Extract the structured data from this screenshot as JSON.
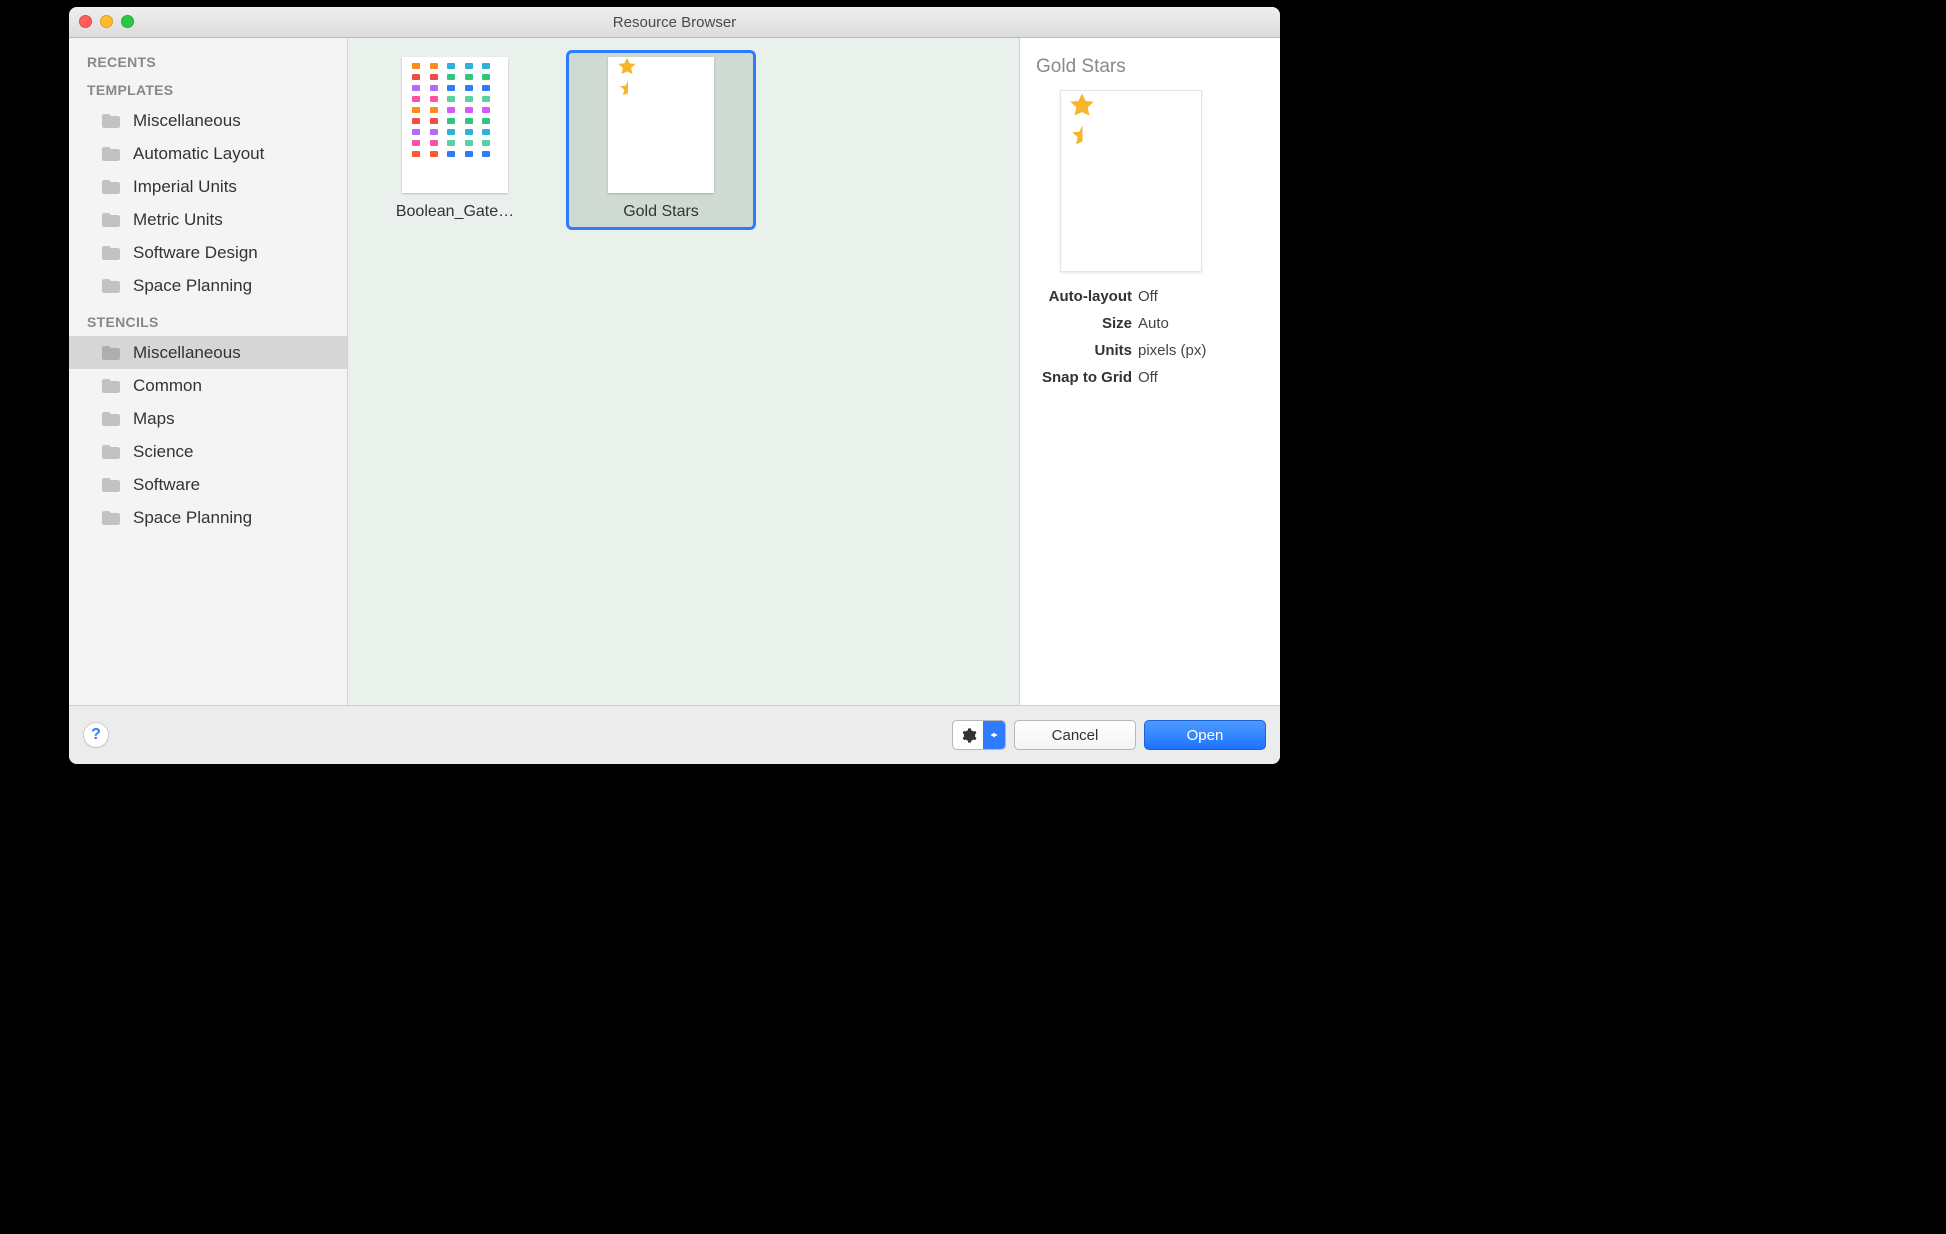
{
  "window": {
    "title": "Resource Browser"
  },
  "sidebar": {
    "section_recents": "RECENTS",
    "section_templates": "TEMPLATES",
    "templates": [
      {
        "label": "Miscellaneous"
      },
      {
        "label": "Automatic Layout"
      },
      {
        "label": "Imperial Units"
      },
      {
        "label": "Metric Units"
      },
      {
        "label": "Software Design"
      },
      {
        "label": "Space Planning"
      }
    ],
    "section_stencils": "STENCILS",
    "stencils": [
      {
        "label": "Miscellaneous",
        "selected": true
      },
      {
        "label": "Common"
      },
      {
        "label": "Maps"
      },
      {
        "label": "Science"
      },
      {
        "label": "Software"
      },
      {
        "label": "Space Planning"
      }
    ]
  },
  "grid": {
    "items": [
      {
        "label": "Boolean_Gate…",
        "kind": "boolean-gates",
        "selected": false
      },
      {
        "label": "Gold Stars",
        "kind": "gold-stars",
        "selected": true
      }
    ]
  },
  "details": {
    "title": "Gold Stars",
    "props": [
      {
        "k": "Auto-layout",
        "v": "Off"
      },
      {
        "k": "Size",
        "v": "Auto"
      },
      {
        "k": "Units",
        "v": "pixels (px)"
      },
      {
        "k": "Snap to Grid",
        "v": "Off"
      }
    ]
  },
  "footer": {
    "help": "?",
    "cancel": "Cancel",
    "open": "Open"
  },
  "colors": {
    "accent": "#2f7bff",
    "star": "#f7b52c"
  }
}
